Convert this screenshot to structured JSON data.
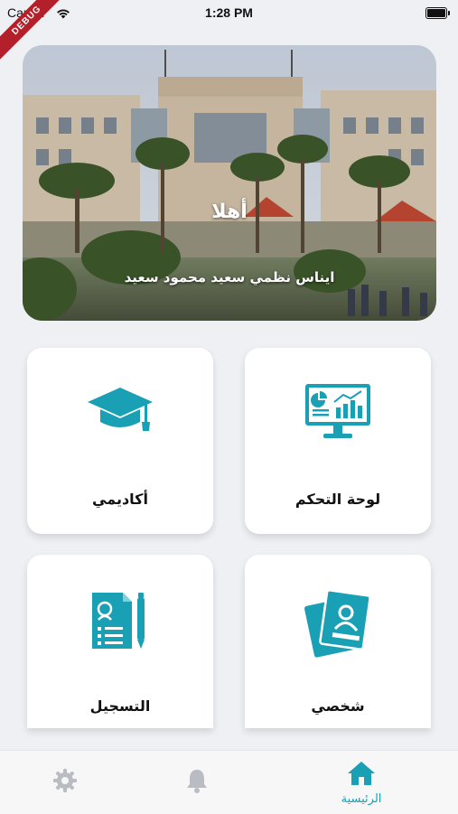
{
  "status_bar": {
    "carrier": "Carrier",
    "time": "1:28 PM"
  },
  "debug_banner": "DEBUG",
  "hero": {
    "greeting": "أهلا",
    "user_name": "ايناس نظمي سعيد محمود سعيد"
  },
  "cards": {
    "dashboard": {
      "label": "لوحة التحكم",
      "icon": "dashboard-monitor-icon"
    },
    "academic": {
      "label": "أكاديمي",
      "icon": "graduation-cap-icon"
    },
    "personal": {
      "label": "شخصي",
      "icon": "id-card-icon"
    },
    "registration": {
      "label": "التسجيل",
      "icon": "registration-form-icon"
    }
  },
  "bottom_nav": {
    "home": {
      "label": "الرئيسية",
      "icon": "home-icon",
      "active": true
    },
    "notifications": {
      "icon": "bell-icon"
    },
    "settings": {
      "icon": "gear-icon"
    }
  },
  "colors": {
    "accent": "#1aa0b4",
    "background": "#eef0f3",
    "inactive_icon": "#b9bcc2",
    "card": "#ffffff"
  }
}
